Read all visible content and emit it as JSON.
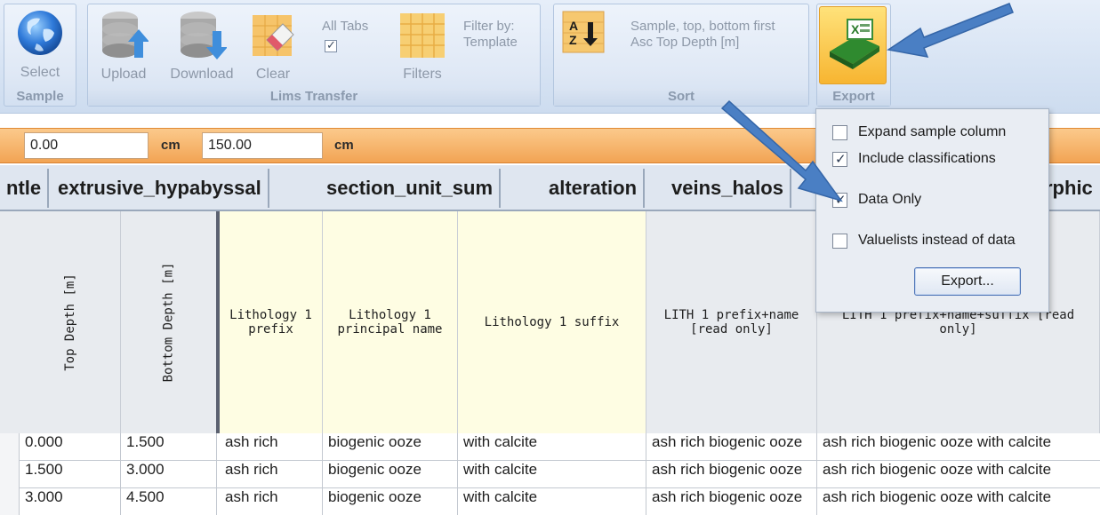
{
  "ribbon": {
    "select_sample": {
      "line1": "Select",
      "line2": "Sample"
    },
    "lims_transfer": {
      "group_label": "Lims Transfer",
      "upload": "Upload",
      "download": "Download",
      "clear": "Clear",
      "all_tabs": {
        "label": "All Tabs",
        "checked": true
      },
      "filters": "Filters",
      "filter_by": {
        "line1": "Filter by:",
        "line2": "Template"
      }
    },
    "sort": {
      "group_label": "Sort",
      "line1": "Sample, top, bottom first",
      "line2": "Asc Top Depth [m]"
    },
    "export": {
      "group_label": "Export"
    }
  },
  "depth_filter": {
    "from_value": "0.00",
    "from_unit": "cm",
    "to_value": "150.00",
    "to_unit": "cm"
  },
  "tabs": [
    "ntle",
    "extrusive_hypabyssal",
    "section_unit_sum",
    "alteration",
    "veins_halos",
    "rphic"
  ],
  "columns": [
    {
      "label": "Top Depth [m]"
    },
    {
      "label": "Bottom Depth [m]"
    },
    {
      "label": "Lithology 1 prefix"
    },
    {
      "label": "Lithology 1 principal name"
    },
    {
      "label": "Lithology 1 suffix"
    },
    {
      "label": "LITH 1 prefix+name [read only]"
    },
    {
      "label": "LITH 1 prefix+name+suffix [read only]"
    }
  ],
  "rows": [
    {
      "top": "0.000",
      "bottom": "1.500",
      "prefix": "ash rich",
      "principal": "biogenic ooze",
      "suffix": "with calcite",
      "prefix_name": "ash rich biogenic ooze",
      "full": "ash rich biogenic ooze with calcite"
    },
    {
      "top": "1.500",
      "bottom": "3.000",
      "prefix": "ash rich",
      "principal": "biogenic ooze",
      "suffix": "with calcite",
      "prefix_name": "ash rich biogenic ooze",
      "full": "ash rich biogenic ooze with calcite"
    },
    {
      "top": "3.000",
      "bottom": "4.500",
      "prefix": "ash rich",
      "principal": "biogenic ooze",
      "suffix": "with calcite",
      "prefix_name": "ash rich biogenic ooze",
      "full": "ash rich biogenic ooze with calcite"
    }
  ],
  "export_menu": {
    "items": [
      {
        "label": "Expand sample column",
        "checked": false
      },
      {
        "label": "Include classifications",
        "checked": true
      },
      {
        "label": "Data Only",
        "checked": true
      },
      {
        "label": "Valuelists instead of data",
        "checked": false
      }
    ],
    "button": "Export..."
  },
  "colors": {
    "accent_orange": "#f2a454",
    "arrow_blue": "#4a7fc4",
    "header_yellow": "#fefde3"
  }
}
